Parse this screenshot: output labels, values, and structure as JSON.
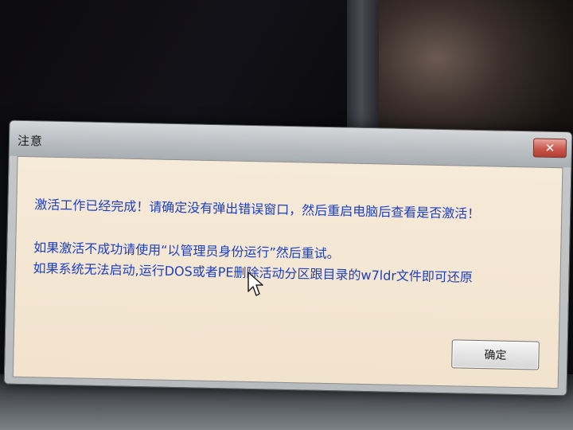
{
  "dialog": {
    "title": "注意",
    "close_glyph": "✕",
    "messages": {
      "line1": "激活工作已经完成！请确定没有弹出错误窗口，然后重启电脑后查看是否激活！",
      "line2": "如果激活不成功请使用“以管理员身份运行”然后重试。",
      "line3": "如果系统无法启动,运行DOS或者PE删除活动分区跟目录的w7ldr文件即可还原"
    },
    "ok_label": "确定"
  },
  "colors": {
    "message_text": "#1c3fbf",
    "content_bg": "#f4e7d3",
    "close_button": "#c9574b"
  },
  "icons": {
    "close": "close-icon",
    "cursor": "mouse-cursor-icon"
  }
}
